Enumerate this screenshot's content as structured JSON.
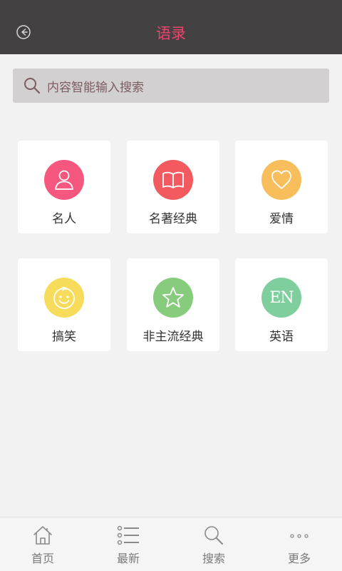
{
  "header": {
    "title": "语录",
    "back_icon": "back-arrow-circle-icon",
    "title_color": "#f0446c",
    "background": "#434141"
  },
  "search": {
    "placeholder": "内容智能输入搜索",
    "icon": "search-icon"
  },
  "categories": [
    {
      "label": "名人",
      "icon": "person-icon",
      "color": "#f5577e"
    },
    {
      "label": "名著经典",
      "icon": "book-icon",
      "color": "#f25a5f"
    },
    {
      "label": "爱情",
      "icon": "heart-icon",
      "color": "#f7be5b"
    },
    {
      "label": "搞笑",
      "icon": "smiley-icon",
      "color": "#f7dc5b"
    },
    {
      "label": "非主流经典",
      "icon": "star-icon",
      "color": "#86cc7c"
    },
    {
      "label": "英语",
      "icon": "en-icon",
      "icon_text": "EN",
      "color": "#7fcf9e"
    }
  ],
  "tabbar": {
    "items": [
      {
        "label": "首页",
        "icon": "home-icon"
      },
      {
        "label": "最新",
        "icon": "list-icon"
      },
      {
        "label": "搜索",
        "icon": "search-icon"
      },
      {
        "label": "更多",
        "icon": "more-icon"
      }
    ]
  }
}
